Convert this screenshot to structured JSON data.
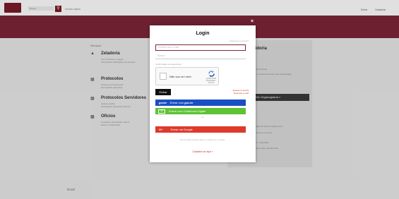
{
  "header": {
    "search_label": "Buscar",
    "top_link": "Acesso rápido",
    "right_links": [
      "Entrar",
      "Cadastrar"
    ]
  },
  "menu": {
    "title": "Serviços",
    "items": [
      {
        "icon": "book-icon",
        "title": "Zeladoria",
        "desc": [
          "Ver protocolos e mapas",
          "Acompanhe solicitações de serviços"
        ]
      },
      {
        "icon": "list-icon",
        "title": "Protocolos",
        "desc": [
          "Acesse seus protocolos",
          "Acompanhe processos"
        ]
      },
      {
        "icon": "list-icon",
        "title": "Protocolos Servidores",
        "desc": [
          "Acesso restrito",
          "Acompanhe processos internos"
        ]
      },
      {
        "icon": "document-icon",
        "title": "Ofícios",
        "desc": [
          "Consulte e acompanhe ofícios",
          "Envio e recebimento"
        ]
      }
    ]
  },
  "right_panel": {
    "title": "Ouvidoria",
    "lines": [
      "Central de Pessoas",
      "Acesse o portal para enviar sua manifestação",
      "Ver Organograma »",
      "Notícias",
      "Atualizações do sistema disponíveis",
      "Novos serviços em breve",
      "Consulte o calendário",
      "Informações sobre atendimento"
    ],
    "button": "Ver Organograma »"
  },
  "footer": {
    "text": "Brasil"
  },
  "modal": {
    "title": "Login",
    "forgot_top": "Esqueceu a senha?",
    "email_placeholder": "Informe seu e-mail",
    "password_placeholder": "Senha",
    "verification_label": "Confirmação de segurança *",
    "recaptcha_text": "Não sou um robô",
    "recaptcha_brand": "reCAPTCHA",
    "recaptcha_terms": "Privacidade - Termos",
    "enter_label": "Entrar",
    "alt_links": [
      "Esqueci a senha",
      "Reenviar e-mail"
    ],
    "gov_label": "Entrar com",
    "gov_brand": "gov.br",
    "gov_badge": "govbr",
    "cert_label": "Entrar com Certificado Digital",
    "cert_icon": "CD",
    "or_label": "ou",
    "google_label": "Entrar via Google",
    "google_icon": "G+",
    "small_note": "Não consegue acessar? Entre em contato com o suporte.",
    "register_label": "Cadastre-se aqui »",
    "close_label": "×"
  }
}
